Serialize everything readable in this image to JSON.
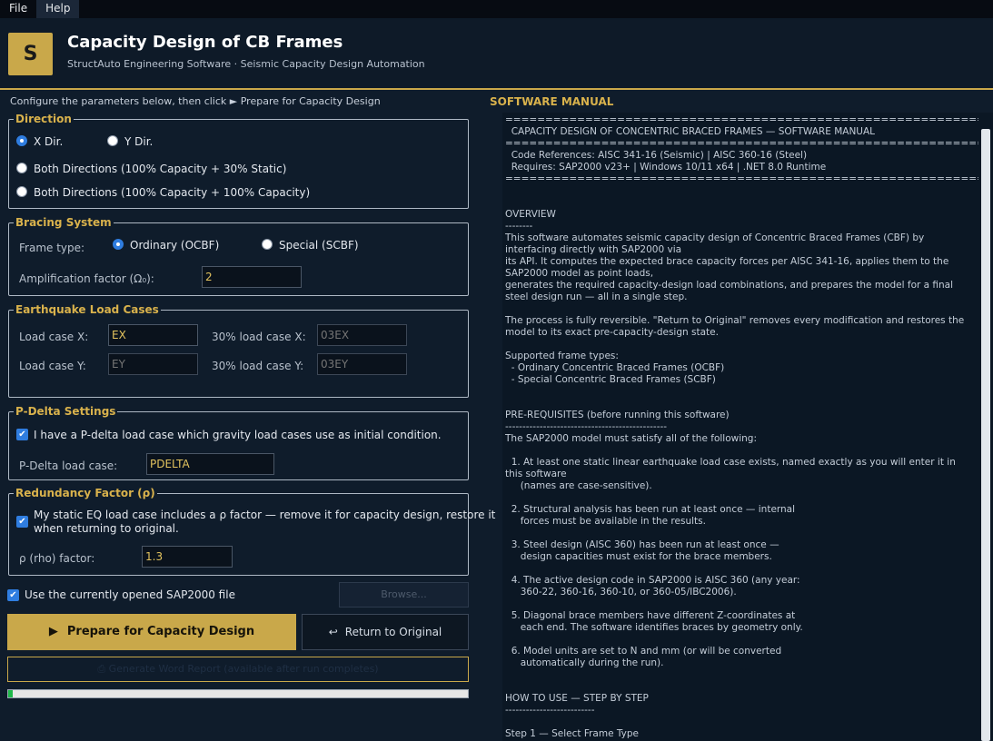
{
  "menu": {
    "file": "File",
    "help": "Help"
  },
  "header": {
    "logo_letter": "S",
    "title": "Capacity Design of CB Frames",
    "subtitle": "StructAuto Engineering Software  ·  Seismic Capacity Design Automation"
  },
  "hint": "Configure the parameters below, then click  ► Prepare for Capacity Design",
  "direction": {
    "title": "Direction",
    "x_dir": "X Dir.",
    "y_dir": "Y Dir.",
    "both_30": "Both Directions  (100% Capacity + 30% Static)",
    "both_100": "Both Directions  (100% Capacity + 100% Capacity)",
    "selected": "X Dir."
  },
  "bracing": {
    "title": "Bracing System",
    "frame_type_label": "Frame type:",
    "ordinary": "Ordinary (OCBF)",
    "special": "Special (SCBF)",
    "selected": "Ordinary (OCBF)",
    "amp_label": "Amplification factor (Ω₀):",
    "amp_value": "2"
  },
  "earthquake": {
    "title": "Earthquake Load Cases",
    "load_x_label": "Load case X:",
    "load_x_value": "EX",
    "load_y_label": "Load case Y:",
    "load_y_placeholder": "EY",
    "pct_x_label": "30% load case X:",
    "pct_x_placeholder": "03EX",
    "pct_y_label": "30% load case Y:",
    "pct_y_placeholder": "03EY"
  },
  "pdelta": {
    "title": "P-Delta Settings",
    "check_label": "I have a P-delta load case which gravity load cases use as initial condition.",
    "checked": true,
    "case_label": "P-Delta load case:",
    "case_value": "PDELTA"
  },
  "redundancy": {
    "title": "Redundancy Factor (ρ)",
    "check_line1": "My static EQ load case includes a ρ factor — remove it for capacity design, restore it",
    "check_line2": "when returning to original.",
    "checked": true,
    "rho_label": "ρ (rho) factor:",
    "rho_value": "1.3"
  },
  "use_current": {
    "label": "Use the currently opened SAP2000 file",
    "checked": true
  },
  "buttons": {
    "browse": "Browse...",
    "prepare": "Prepare for Capacity Design",
    "return": "Return to Original",
    "report": "⎙  Generate Word Report  (available after run completes)"
  },
  "progress": {
    "fraction": 0.01
  },
  "manual": {
    "title": "SOFTWARE MANUAL",
    "text": "================================================================\n  CAPACITY DESIGN OF CONCENTRIC BRACED FRAMES — SOFTWARE MANUAL\n================================================================\n  Code References: AISC 341-16 (Seismic) | AISC 360-16 (Steel)\n  Requires: SAP2000 v23+ | Windows 10/11 x64 | .NET 8.0 Runtime\n================================================================\n\n\nOVERVIEW\n--------\nThis software automates seismic capacity design of Concentric Braced Frames (CBF) by interfacing directly with SAP2000 via\nits API. It computes the expected brace capacity forces per AISC 341-16, applies them to the SAP2000 model as point loads,\ngenerates the required capacity-design load combinations, and prepares the model for a final steel design run — all in a single step.\n\nThe process is fully reversible. \"Return to Original\" removes every modification and restores the model to its exact pre-capacity-design state.\n\nSupported frame types:\n  - Ordinary Concentric Braced Frames (OCBF)\n  - Special Concentric Braced Frames (SCBF)\n\n\nPRE-REQUISITES (before running this software)\n-----------------------------------------------\nThe SAP2000 model must satisfy all of the following:\n\n  1. At least one static linear earthquake load case exists, named exactly as you will enter it in this software\n     (names are case-sensitive).\n\n  2. Structural analysis has been run at least once — internal\n     forces must be available in the results.\n\n  3. Steel design (AISC 360) has been run at least once —\n     design capacities must exist for the brace members.\n\n  4. The active design code in SAP2000 is AISC 360 (any year:\n     360-22, 360-16, 360-10, or 360-05/IBC2006).\n\n  5. Diagonal brace members have different Z-coordinates at\n     each end. The software identifies braces by geometry only.\n\n  6. Model units are set to N and mm (or will be converted\n     automatically during the run).\n\n\nHOW TO USE — STEP BY STEP\n--------------------------\n\nStep 1 — Select Frame Type"
  }
}
